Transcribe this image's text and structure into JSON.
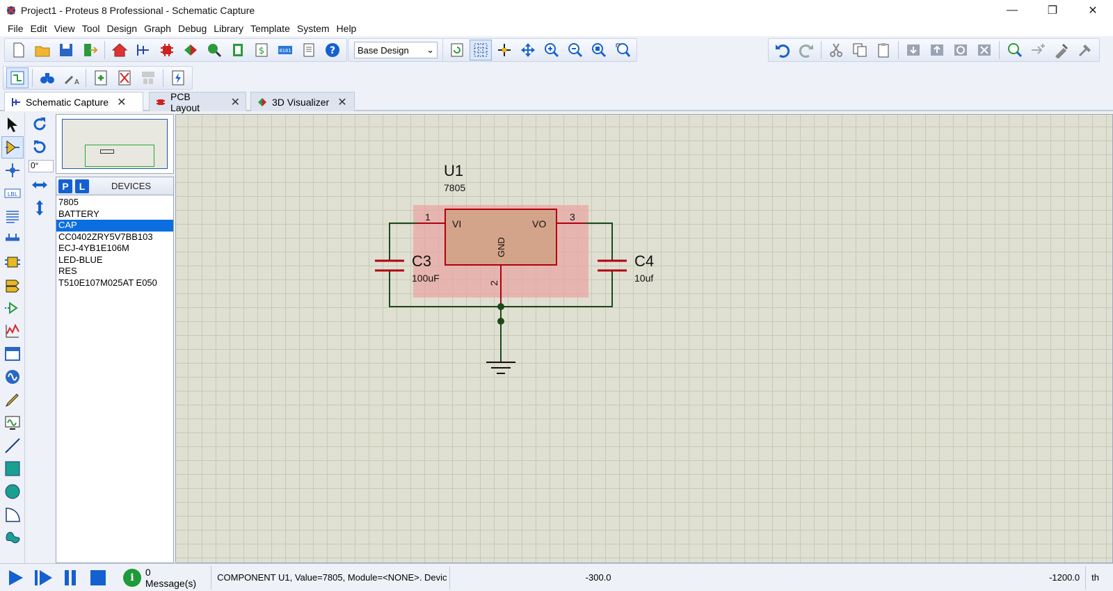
{
  "window": {
    "title": "Project1 - Proteus 8 Professional - Schematic Capture",
    "minimize": "—",
    "restore": "❐",
    "close": "✕"
  },
  "menu": [
    "File",
    "Edit",
    "View",
    "Tool",
    "Design",
    "Graph",
    "Debug",
    "Library",
    "Template",
    "System",
    "Help"
  ],
  "toolbar": {
    "variant_select": "Base Design"
  },
  "tabs": [
    {
      "label": "Schematic Capture",
      "close": "✕"
    },
    {
      "label": "PCB Layout",
      "close": "✕"
    },
    {
      "label": "3D Visualizer",
      "close": "✕"
    }
  ],
  "left_toolbar": {
    "angle": "0°"
  },
  "devices": {
    "p_label": "P",
    "l_label": "L",
    "title": "DEVICES",
    "items": [
      "7805",
      "BATTERY",
      "CAP",
      "CC0402ZRY5V7BB103",
      "ECJ-4YB1E106M",
      "LED-BLUE",
      "RES",
      "T510E107M025AT E050"
    ],
    "selected": "CAP"
  },
  "schematic": {
    "u1_ref": "U1",
    "u1_value": "7805",
    "pin_vi": "VI",
    "pin_vo": "VO",
    "pin_gnd": "GND",
    "pin1": "1",
    "pin3": "3",
    "pin2": "2",
    "c3_ref": "C3",
    "c3_value": "100uF",
    "c4_ref": "C4",
    "c4_value": "10uf"
  },
  "status": {
    "messages": "0 Message(s)",
    "info": "i",
    "component": "COMPONENT U1, Value=7805, Module=<NONE>. Devic",
    "x_coord": "-300.0",
    "y_coord": "-1200.0",
    "units": "th"
  }
}
